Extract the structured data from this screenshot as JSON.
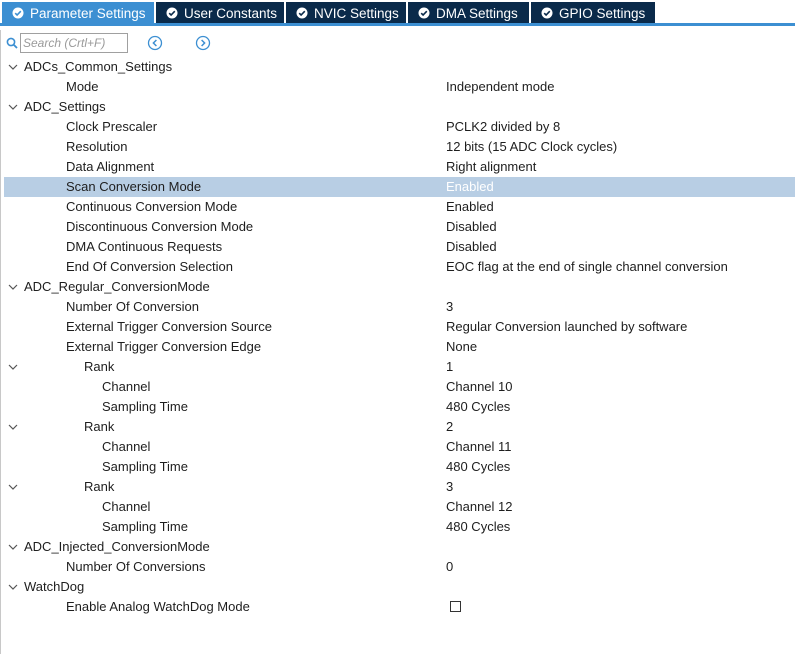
{
  "tabs": [
    {
      "label": "Parameter Settings",
      "active": true
    },
    {
      "label": "User Constants",
      "active": false
    },
    {
      "label": "NVIC Settings",
      "active": false
    },
    {
      "label": "DMA Settings",
      "active": false
    },
    {
      "label": "GPIO Settings",
      "active": false
    }
  ],
  "search": {
    "placeholder": "Search (Crtl+F)",
    "value": ""
  },
  "tree": [
    {
      "type": "group",
      "label": "ADCs_Common_Settings"
    },
    {
      "type": "item",
      "label": "Mode",
      "value": "Independent mode"
    },
    {
      "type": "group",
      "label": "ADC_Settings"
    },
    {
      "type": "item",
      "label": "Clock Prescaler",
      "value": "PCLK2 divided by 8"
    },
    {
      "type": "item",
      "label": "Resolution",
      "value": "12 bits (15 ADC Clock cycles)"
    },
    {
      "type": "item",
      "label": "Data Alignment",
      "value": "Right alignment"
    },
    {
      "type": "item",
      "label": "Scan Conversion Mode",
      "value": "Enabled",
      "selected": true
    },
    {
      "type": "item",
      "label": "Continuous Conversion Mode",
      "value": "Enabled"
    },
    {
      "type": "item",
      "label": "Discontinuous Conversion Mode",
      "value": "Disabled"
    },
    {
      "type": "item",
      "label": "DMA Continuous Requests",
      "value": "Disabled"
    },
    {
      "type": "item",
      "label": "End Of Conversion Selection",
      "value": "EOC flag at the end of single channel conversion"
    },
    {
      "type": "group",
      "label": "ADC_Regular_ConversionMode"
    },
    {
      "type": "item",
      "label": "Number Of Conversion",
      "value": "3"
    },
    {
      "type": "item",
      "label": "External Trigger Conversion Source",
      "value": "Regular Conversion launched by software"
    },
    {
      "type": "item",
      "label": "External Trigger Conversion Edge",
      "value": "None"
    },
    {
      "type": "subgroup",
      "label": "Rank",
      "value": "1"
    },
    {
      "type": "subitem",
      "label": "Channel",
      "value": "Channel 10"
    },
    {
      "type": "subitem",
      "label": "Sampling Time",
      "value": "480 Cycles"
    },
    {
      "type": "subgroup",
      "label": "Rank",
      "value": "2"
    },
    {
      "type": "subitem",
      "label": "Channel",
      "value": "Channel 11"
    },
    {
      "type": "subitem",
      "label": "Sampling Time",
      "value": "480 Cycles"
    },
    {
      "type": "subgroup",
      "label": "Rank",
      "value": "3"
    },
    {
      "type": "subitem",
      "label": "Channel",
      "value": "Channel 12"
    },
    {
      "type": "subitem",
      "label": "Sampling Time",
      "value": "480 Cycles"
    },
    {
      "type": "group",
      "label": "ADC_Injected_ConversionMode"
    },
    {
      "type": "item",
      "label": "Number Of Conversions",
      "value": "0"
    },
    {
      "type": "group",
      "label": "WatchDog"
    },
    {
      "type": "checkbox",
      "label": "Enable Analog WatchDog Mode",
      "checked": false
    }
  ],
  "colors": {
    "tab_active": "#3c8fd2",
    "tab_inactive": "#0a2a4a",
    "selected_row": "#b8cee4",
    "nav_icon": "#3c8fd2"
  },
  "icons": {
    "tab": "check-circle-icon",
    "search": "search-icon",
    "prev": "back-circle-icon",
    "next": "forward-circle-icon",
    "expand": "chevron-down-icon"
  }
}
